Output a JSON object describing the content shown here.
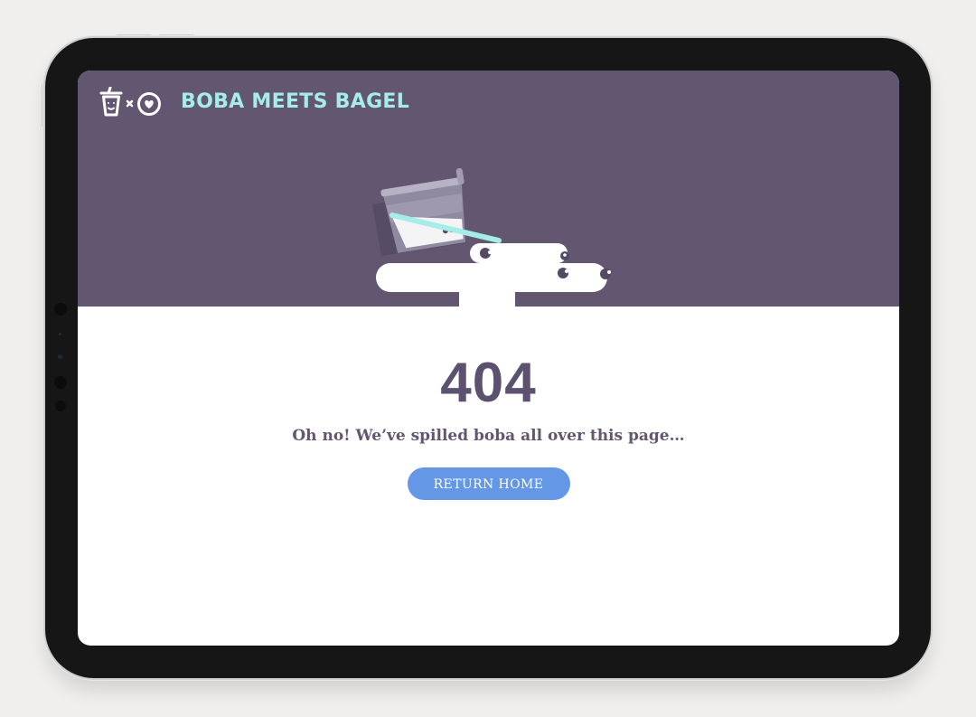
{
  "header": {
    "brand_name": "BOBA MEETS BAGEL",
    "logo_icons": [
      "boba-cup-icon",
      "times-icon",
      "bagel-heart-icon"
    ],
    "brand_color": "#a6ece8",
    "banner_color": "#625670"
  },
  "illustration": {
    "icon": "spilled-boba-cup-icon"
  },
  "error": {
    "code": "404",
    "message": "Oh no! We’ve spilled boba all over this page…"
  },
  "actions": {
    "return_home_label": "RETURN HOME",
    "button_color": "#6497e6"
  }
}
